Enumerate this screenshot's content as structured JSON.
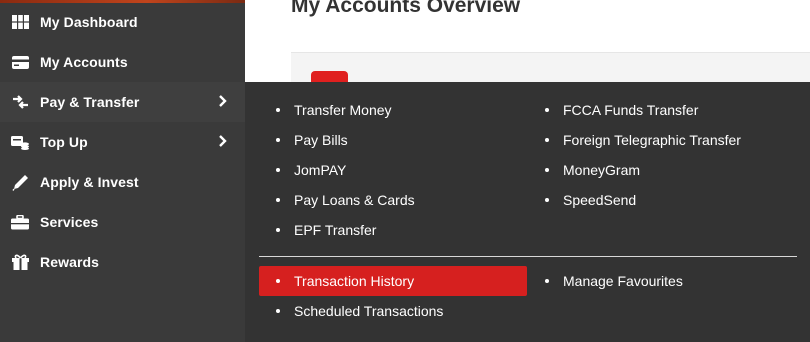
{
  "page": {
    "title": "My Accounts Overview"
  },
  "sidebar": {
    "items": [
      {
        "label": "My Dashboard",
        "icon": "grid-icon"
      },
      {
        "label": "My Accounts",
        "icon": "card-icon"
      },
      {
        "label": "Pay & Transfer",
        "icon": "transfer-icon",
        "has_submenu": true
      },
      {
        "label": "Top Up",
        "icon": "coins-icon",
        "has_submenu": true
      },
      {
        "label": "Apply & Invest",
        "icon": "pen-icon"
      },
      {
        "label": "Services",
        "icon": "briefcase-icon"
      },
      {
        "label": "Rewards",
        "icon": "gift-icon"
      }
    ]
  },
  "menu": {
    "col1": [
      "Transfer Money",
      "Pay Bills",
      "JomPAY",
      "Pay Loans & Cards",
      "EPF Transfer"
    ],
    "col2": [
      "FCCA Funds Transfer",
      "Foreign Telegraphic Transfer",
      "MoneyGram",
      "SpeedSend"
    ],
    "lower_col1": [
      "Transaction History",
      "Scheduled Transactions"
    ],
    "lower_col2": [
      "Manage Favourites"
    ],
    "selected": "Transaction History"
  },
  "colors": {
    "accent": "#d6201f",
    "sidebar_bg": "#3a3a3a",
    "menu_bg": "#333333"
  }
}
